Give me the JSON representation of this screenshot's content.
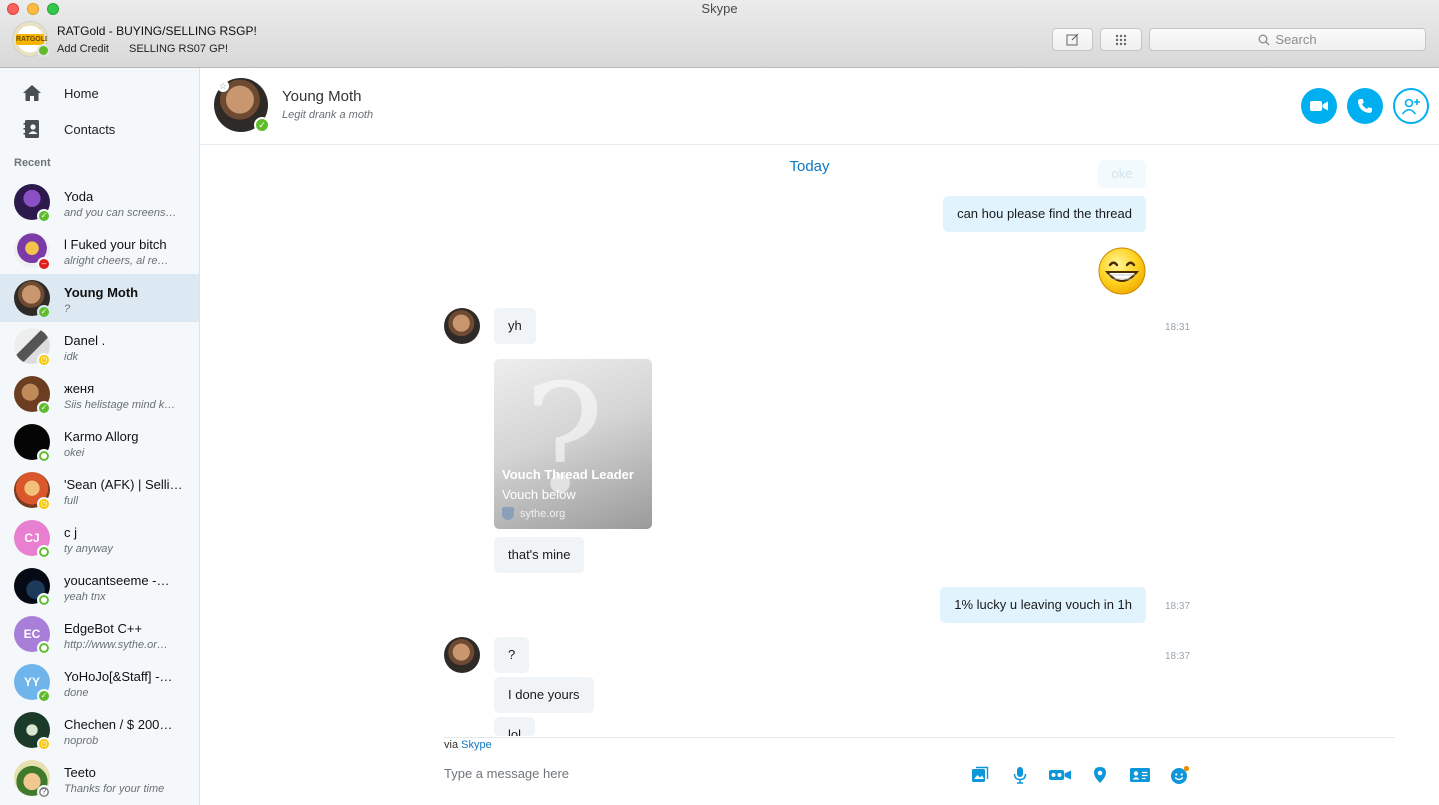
{
  "window": {
    "title": "Skype"
  },
  "profile": {
    "name": "RATGold - BUYING/SELLING RSGP!",
    "credit": "Add Credit",
    "mood": "SELLING RS07 GP!",
    "logo_text": "RATGOLD"
  },
  "toolbar": {
    "search_placeholder": "Search"
  },
  "sidebar": {
    "home_label": "Home",
    "contacts_label": "Contacts",
    "recent_label": "Recent",
    "contacts": [
      {
        "name": "Yoda",
        "message": "and you can screens…",
        "status": "online",
        "initials": ""
      },
      {
        "name": "l Fuked your bitch",
        "message": "alright cheers, al re…",
        "status": "dnd",
        "initials": ""
      },
      {
        "name": "Young Moth",
        "message": "?",
        "status": "online",
        "initials": ""
      },
      {
        "name": "Danel .",
        "message": "idk",
        "status": "away",
        "initials": ""
      },
      {
        "name": "женя",
        "message": "Siis helistage mind k…",
        "status": "online",
        "initials": ""
      },
      {
        "name": "Karmo Allorg",
        "message": "okei",
        "status": "offline",
        "initials": ""
      },
      {
        "name": "'Sean (AFK) | Selli…",
        "message": "full",
        "status": "away",
        "initials": ""
      },
      {
        "name": "c j",
        "message": "ty anyway",
        "status": "offline",
        "initials": "CJ"
      },
      {
        "name": "youcantseeme -…",
        "message": "yeah tnx",
        "status": "offline",
        "initials": ""
      },
      {
        "name": "EdgeBot C++",
        "message": "http://www.sythe.or…",
        "status": "offline",
        "initials": "EC"
      },
      {
        "name": "YoHoJo[&Staff] -…",
        "message": "done",
        "status": "online",
        "initials": "YY"
      },
      {
        "name": "Chechen / $ 200…",
        "message": "noprob",
        "status": "away",
        "initials": ""
      },
      {
        "name": "Teeto",
        "message": "Thanks for your time",
        "status": "unknown",
        "initials": ""
      }
    ]
  },
  "chat": {
    "name": "Young Moth",
    "mood": "Legit drank a moth",
    "day_label": "Today",
    "ghost_message": "oke",
    "messages": [
      {
        "text": "can hou please find the thread",
        "dir": "out"
      },
      {
        "text": "yh",
        "dir": "in",
        "time": "18:31"
      },
      {
        "text": "that's mine",
        "dir": "in"
      },
      {
        "text": "1% lucky u leaving vouch in 1h",
        "dir": "out",
        "time": "18:37"
      },
      {
        "text": "?",
        "dir": "in",
        "time": "18:37"
      },
      {
        "text": "I done yours",
        "dir": "in"
      },
      {
        "text": "lol",
        "dir": "in"
      }
    ],
    "link_card": {
      "title": "Vouch Thread Leader",
      "description": "Vouch below",
      "site": "sythe.org"
    }
  },
  "composer": {
    "via_prefix": "via",
    "via_brand": "Skype",
    "placeholder": "Type a message here"
  },
  "colors": {
    "accent": "#00aff0",
    "link": "#0d78c0",
    "online": "#5fbd2c",
    "away": "#f8c700",
    "dnd": "#e0201b",
    "outgoing_bubble": "#e1f4fd",
    "incoming_bubble": "#f1f4f6"
  }
}
